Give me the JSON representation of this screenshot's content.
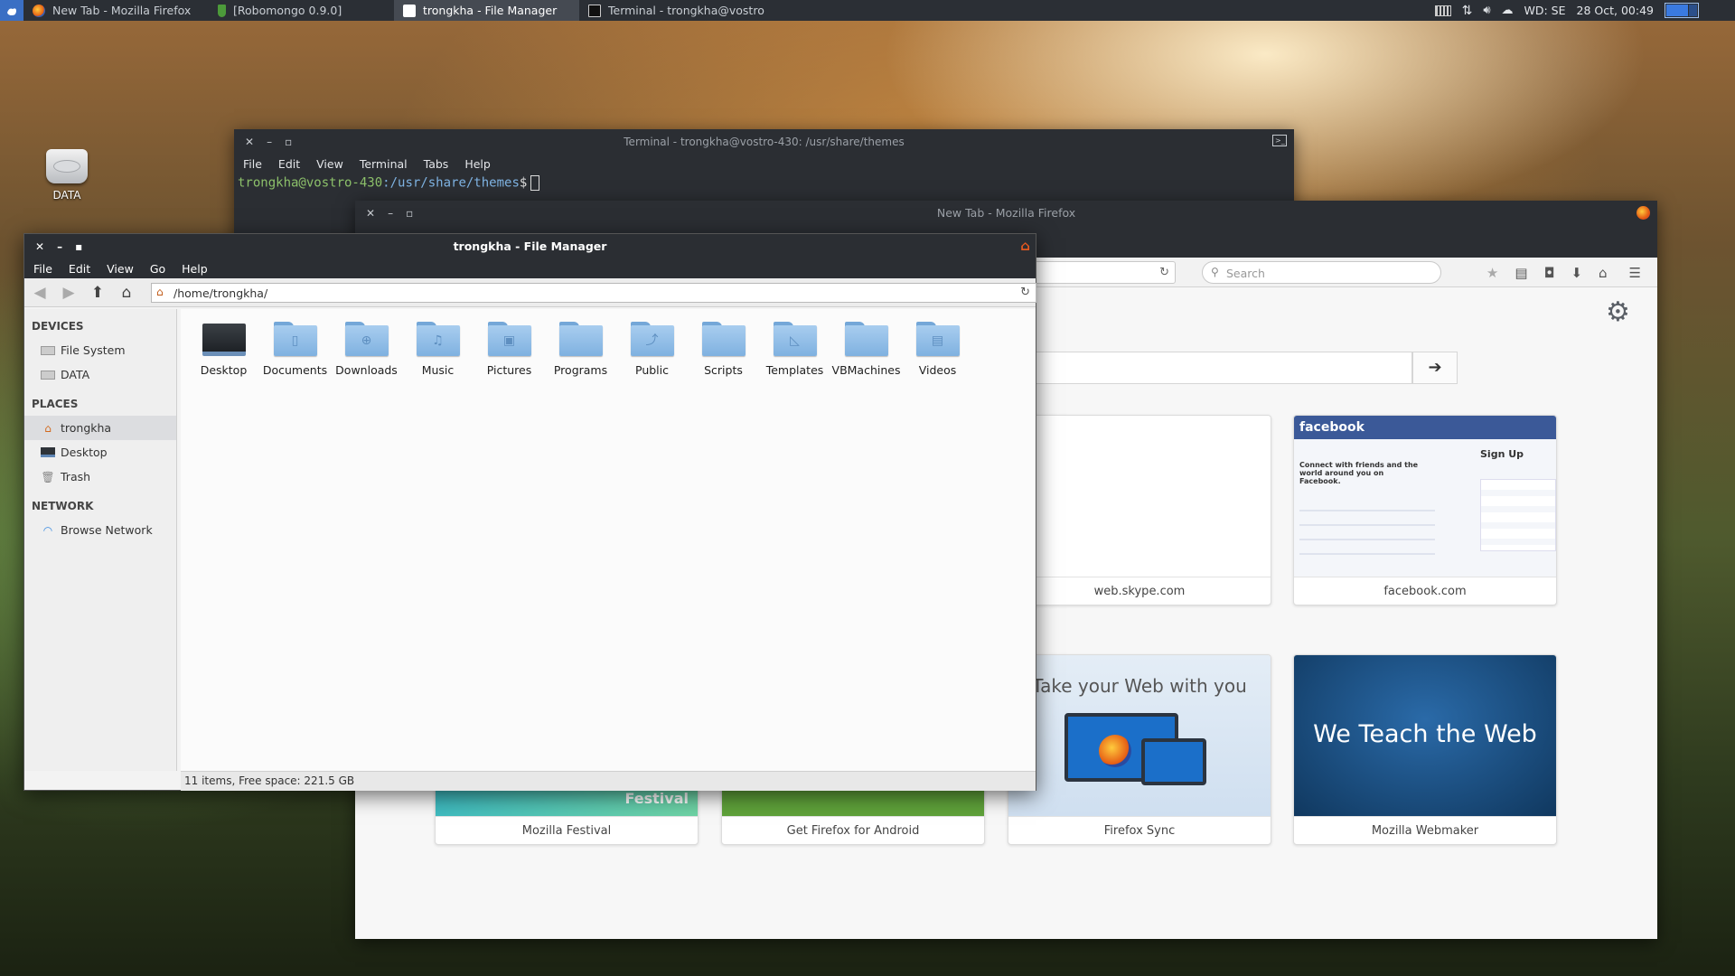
{
  "taskbar": {
    "tasks": [
      {
        "label": "New Tab - Mozilla Firefox",
        "active": false
      },
      {
        "label": "[Robomongo 0.9.0]",
        "active": false
      },
      {
        "label": "trongkha - File Manager",
        "active": true
      },
      {
        "label": "Terminal - trongkha@vostro-...",
        "active": false
      }
    ],
    "keyboard_layout": "WD: SE",
    "clock": "28 Oct, 00:49"
  },
  "desktop": {
    "icons": [
      {
        "label": "DATA"
      }
    ]
  },
  "terminal": {
    "title": "Terminal - trongkha@vostro-430: /usr/share/themes",
    "menu": [
      "File",
      "Edit",
      "View",
      "Terminal",
      "Tabs",
      "Help"
    ],
    "prompt_user": "trongkha@vostro-430",
    "prompt_path": ":/usr/share/themes",
    "prompt_symbol": "$"
  },
  "firefox": {
    "title": "New Tab - Mozilla Firefox",
    "search_placeholder": "Search",
    "tiles": [
      {
        "caption": "web.skype.com"
      },
      {
        "caption": "facebook.com"
      },
      {
        "caption": "Mozilla Festival",
        "thumb_text": "Festival"
      },
      {
        "caption": "Get Firefox for Android"
      },
      {
        "caption": "Firefox Sync",
        "thumb_text": "Take your Web with you"
      },
      {
        "caption": "Mozilla Webmaker",
        "thumb_text": "We Teach the Web"
      }
    ],
    "facebook": {
      "logo": "facebook",
      "signup": "Sign Up",
      "tagline": "Connect with friends and the world around you on Facebook."
    }
  },
  "file_manager": {
    "title": "trongkha - File Manager",
    "menu": [
      "File",
      "Edit",
      "View",
      "Go",
      "Help"
    ],
    "location": "/home/trongkha/",
    "sidebar": {
      "sections": [
        {
          "heading": "DEVICES",
          "items": [
            "File System",
            "DATA"
          ]
        },
        {
          "heading": "PLACES",
          "items": [
            "trongkha",
            "Desktop",
            "Trash"
          ]
        },
        {
          "heading": "NETWORK",
          "items": [
            "Browse Network"
          ]
        }
      ]
    },
    "files": [
      "Desktop",
      "Documents",
      "Downloads",
      "Music",
      "Pictures",
      "Programs",
      "Public",
      "Scripts",
      "Templates",
      "VBMachines",
      "Videos"
    ],
    "status": "11 items, Free space: 221.5 GB"
  },
  "colors": {
    "accent": "#3a7ae0",
    "folder": "#8dbbe8",
    "panel": "#2b2f35"
  }
}
